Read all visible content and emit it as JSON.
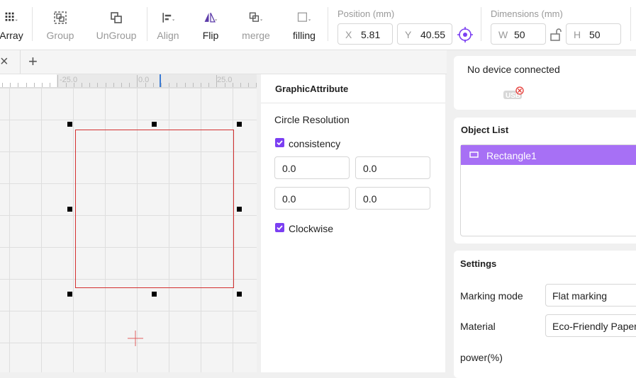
{
  "toolbar": {
    "array_label": "Array",
    "group_label": "Group",
    "ungroup_label": "UnGroup",
    "align_label": "Align",
    "flip_label": "Flip",
    "merge_label": "merge",
    "filling_label": "filling",
    "position": {
      "title": "Position (mm)",
      "x_prefix": "X",
      "x_value": "5.81",
      "y_prefix": "Y",
      "y_value": "40.55"
    },
    "dimensions": {
      "title": "Dimensions (mm)",
      "w_prefix": "W",
      "w_value": "50",
      "h_prefix": "H",
      "h_value": "50"
    }
  },
  "tabs": {
    "close_glyph": "×",
    "add_glyph": "+"
  },
  "ruler": {
    "labels": [
      "-25.0",
      "0.0",
      "25.0"
    ]
  },
  "attributes": {
    "title": "GraphicAttribute",
    "circle_resolution": "Circle Resolution",
    "consistency_label": "consistency",
    "consistency_checked": true,
    "fields": [
      "0.0",
      "0.0",
      "0.0",
      "0.0"
    ],
    "clockwise_label": "Clockwise",
    "clockwise_checked": true
  },
  "device": {
    "status": "No device connected",
    "icon": "usb-disconnected-icon"
  },
  "object_list": {
    "title": "Object List",
    "items": [
      {
        "name": "Rectangle1",
        "icon": "rectangle-icon",
        "selected": true
      }
    ]
  },
  "settings": {
    "title": "Settings",
    "marking_mode_label": "Marking mode",
    "marking_mode_value": "Flat marking",
    "material_label": "Material",
    "material_value": "Eco-Friendly Paper",
    "power_label": "power(%)"
  },
  "colors": {
    "accent": "#7b3ff2",
    "selection_row": "#a770f5",
    "shape_stroke": "#d32f2f"
  }
}
